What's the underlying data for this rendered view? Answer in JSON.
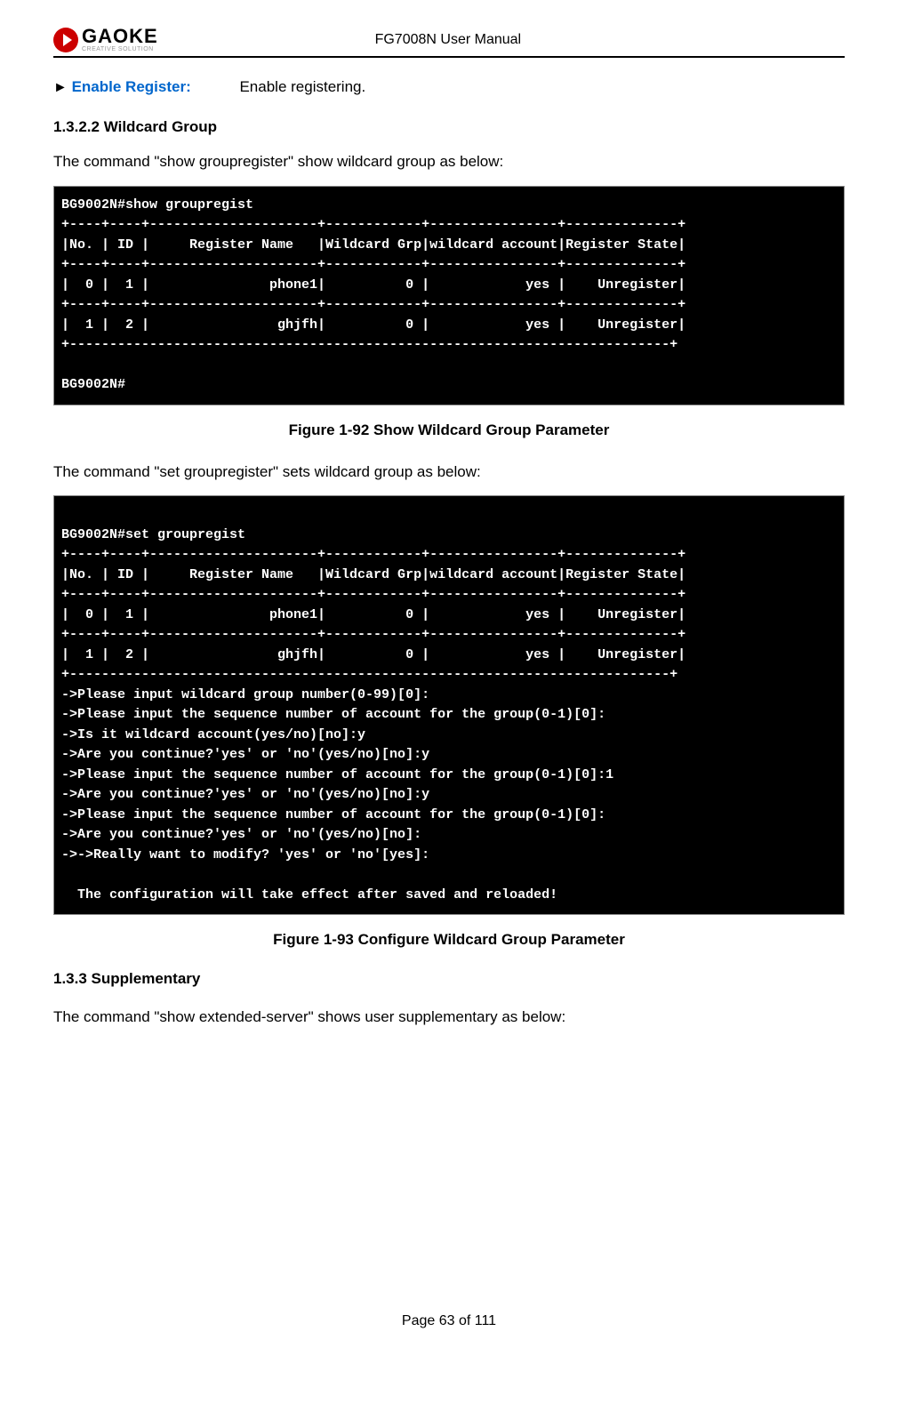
{
  "header": {
    "logo_main": "GAOKE",
    "logo_sub": "CREATIVE SOLUTION",
    "title": "FG7008N User Manual"
  },
  "enable_register": {
    "arrow": "►",
    "label": "Enable Register:",
    "desc": "Enable registering."
  },
  "section_1_3_2_2": {
    "heading": "1.3.2.2    Wildcard Group",
    "intro": "The command \"show groupregister\" show wildcard group as below:",
    "terminal": "BG9002N#show groupregist\n+----+----+---------------------+------------+----------------+--------------+\n|No. | ID |     Register Name   |Wildcard Grp|wildcard account|Register State|\n+----+----+---------------------+------------+----------------+--------------+\n|  0 |  1 |               phone1|          0 |            yes |    Unregister|\n+----+----+---------------------+------------+----------------+--------------+\n|  1 |  2 |                ghjfh|          0 |            yes |    Unregister|\n+---------------------------------------------------------------------------+\n\nBG9002N#",
    "caption": "Figure 1-92    Show Wildcard Group Parameter",
    "intro2": "The command \"set groupregister\" sets wildcard group as below:",
    "terminal2": "\nBG9002N#set groupregist\n+----+----+---------------------+------------+----------------+--------------+\n|No. | ID |     Register Name   |Wildcard Grp|wildcard account|Register State|\n+----+----+---------------------+------------+----------------+--------------+\n|  0 |  1 |               phone1|          0 |            yes |    Unregister|\n+----+----+---------------------+------------+----------------+--------------+\n|  1 |  2 |                ghjfh|          0 |            yes |    Unregister|\n+---------------------------------------------------------------------------+\n->Please input wildcard group number(0-99)[0]:\n->Please input the sequence number of account for the group(0-1)[0]:\n->Is it wildcard account(yes/no)[no]:y\n->Are you continue?'yes' or 'no'(yes/no)[no]:y\n->Please input the sequence number of account for the group(0-1)[0]:1\n->Are you continue?'yes' or 'no'(yes/no)[no]:y\n->Please input the sequence number of account for the group(0-1)[0]:\n->Are you continue?'yes' or 'no'(yes/no)[no]:\n->->Really want to modify? 'yes' or 'no'[yes]:\n\n  The configuration will take effect after saved and reloaded!",
    "caption2": "Figure 1-93    Configure Wildcard Group Parameter"
  },
  "section_1_3_3": {
    "heading": "1.3.3    Supplementary",
    "intro": "The command \"show extended-server\" shows user supplementary as below:"
  },
  "footer": {
    "page_info": "Page 63 of 111"
  }
}
